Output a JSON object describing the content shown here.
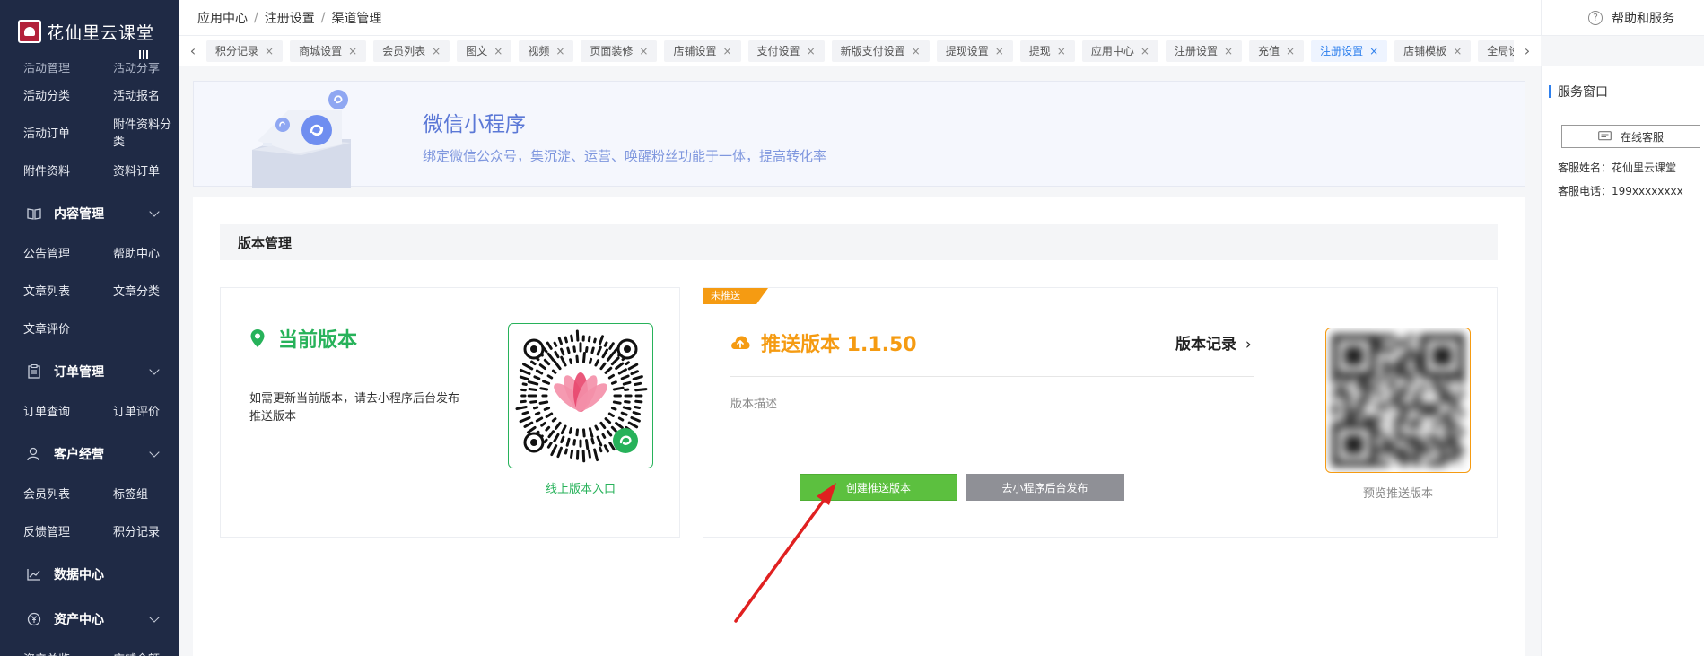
{
  "brand": {
    "name": "花仙里云课堂"
  },
  "sidebar": {
    "top_cut": [
      "活动管理",
      "活动分享"
    ],
    "rows_1": [
      "活动分类",
      "活动报名",
      "活动订单",
      "附件资料分类",
      "附件资料",
      "资料订单"
    ],
    "group_content": "内容管理",
    "rows_content": [
      "公告管理",
      "帮助中心",
      "文章列表",
      "文章分类",
      "文章评价"
    ],
    "group_order": "订单管理",
    "rows_order": [
      "订单查询",
      "订单评价"
    ],
    "group_customer": "客户经营",
    "rows_customer": [
      "会员列表",
      "标签组",
      "反馈管理",
      "积分记录"
    ],
    "group_data": "数据中心",
    "group_assets": "资产中心",
    "rows_assets": [
      "资产总览",
      "店铺余额"
    ]
  },
  "breadcrumb": [
    "应用中心",
    "注册设置",
    "渠道管理"
  ],
  "help": {
    "label": "帮助和服务",
    "icon_char": "?"
  },
  "tabs": [
    {
      "label": "积分记录"
    },
    {
      "label": "商城设置"
    },
    {
      "label": "会员列表"
    },
    {
      "label": "图文"
    },
    {
      "label": "视频"
    },
    {
      "label": "页面装修"
    },
    {
      "label": "店铺设置"
    },
    {
      "label": "支付设置"
    },
    {
      "label": "新版支付设置"
    },
    {
      "label": "提现设置"
    },
    {
      "label": "提现"
    },
    {
      "label": "应用中心"
    },
    {
      "label": "注册设置"
    },
    {
      "label": "充值"
    },
    {
      "label": "注册设置"
    },
    {
      "label": "店铺模板"
    },
    {
      "label": "全局设置"
    }
  ],
  "active_tab_index": 14,
  "tab_close_glyph": "×",
  "tab_prev_glyph": "‹",
  "tab_next_glyph": "›",
  "banner": {
    "title": "微信小程序",
    "subtitle": "绑定微信公众号，集沉淀、运营、唤醒粉丝功能于一体，提高转化率"
  },
  "section": {
    "title": "版本管理"
  },
  "current_version": {
    "title": "当前版本",
    "note": "如需更新当前版本，请去小程序后台发布推送版本",
    "qr_link": "线上版本入口"
  },
  "push_version": {
    "ribbon": "未推送",
    "title": "推送版本 1.1.50",
    "history_label": "版本记录",
    "history_chevron": "›",
    "desc_label": "版本描述",
    "create_button": "创建推送版本",
    "publish_button": "去小程序后台发布",
    "preview_label": "预览推送版本"
  },
  "service": {
    "title": "服务窗口",
    "online_button": "在线客服",
    "name_line": "客服姓名：花仙里云课堂",
    "phone_line": "客服电话：199xxxxxxxx"
  },
  "colors": {
    "sidebar_bg": "#1f2a45",
    "accent_blue": "#2f80ed",
    "green": "#27b25a",
    "orange": "#f59b12",
    "button_green": "#5cc03f",
    "button_grey": "#8f9096",
    "annotation_red": "#e02020"
  }
}
